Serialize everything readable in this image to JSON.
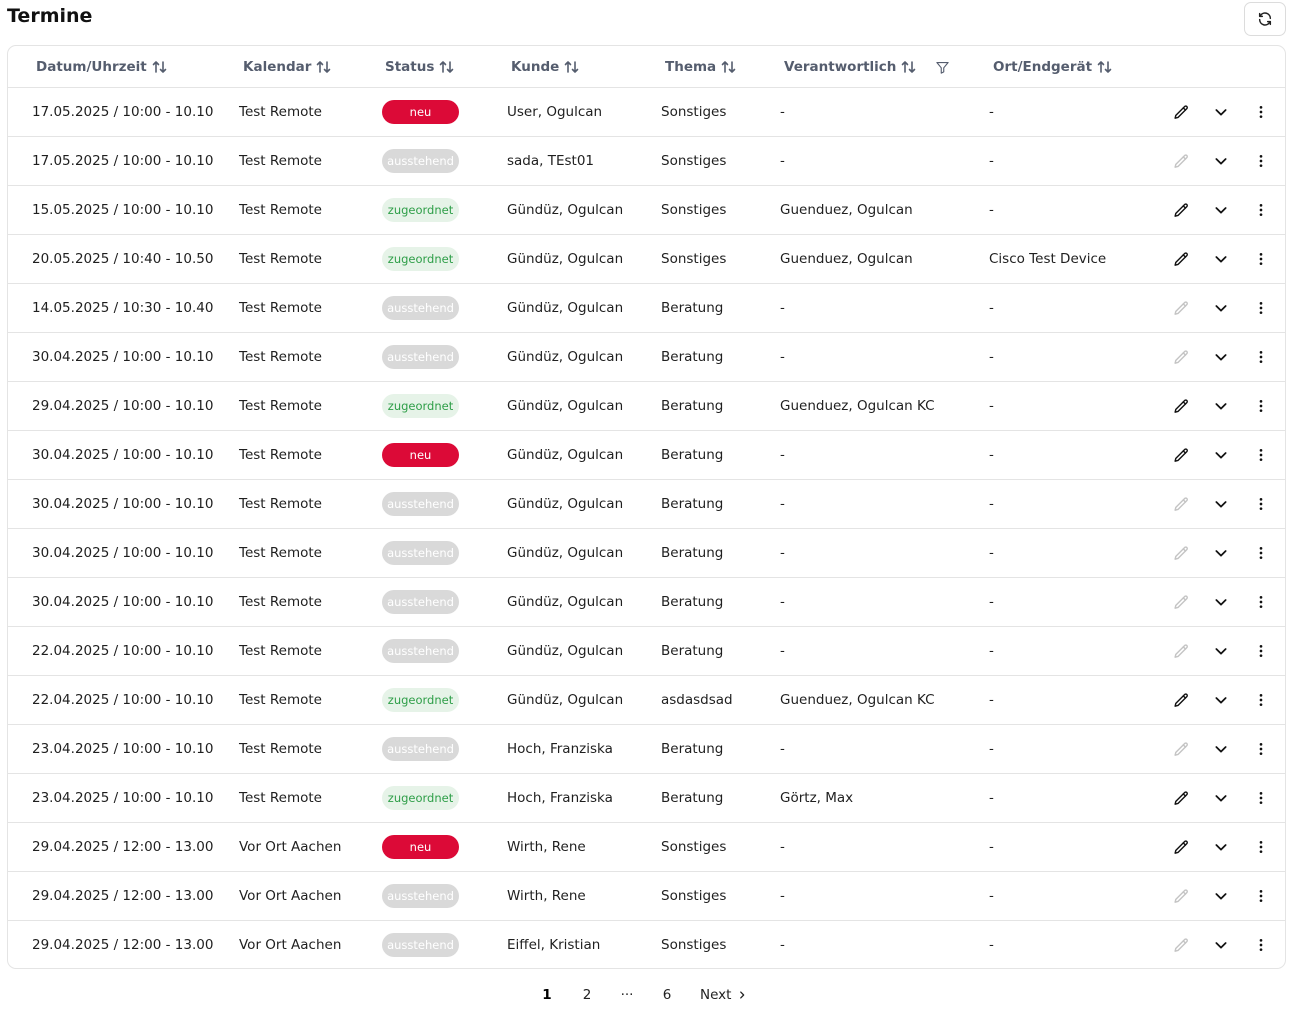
{
  "page": {
    "title": "Termine"
  },
  "toolbar": {
    "refresh_icon": "refresh-icon"
  },
  "table": {
    "columns": [
      {
        "key": "datum",
        "label": "Datum/Uhrzeit",
        "sortable": true,
        "filter": false
      },
      {
        "key": "kalender",
        "label": "Kalendar",
        "sortable": true,
        "filter": false
      },
      {
        "key": "status",
        "label": "Status",
        "sortable": true,
        "filter": false
      },
      {
        "key": "kunde",
        "label": "Kunde",
        "sortable": true,
        "filter": false
      },
      {
        "key": "thema",
        "label": "Thema",
        "sortable": true,
        "filter": false
      },
      {
        "key": "verantwortlich",
        "label": "Verantwortlich",
        "sortable": true,
        "filter": true
      },
      {
        "key": "ort",
        "label": "Ort/Endgerät",
        "sortable": true,
        "filter": false
      }
    ],
    "rows": [
      {
        "datum": "17.05.2025 / 10:00 - 10.10",
        "kalender": "Test Remote",
        "status": "neu",
        "kunde": "User, Ogulcan",
        "thema": "Sonstiges",
        "verantwortlich": "-",
        "ort": "-",
        "editable": true
      },
      {
        "datum": "17.05.2025 / 10:00 - 10.10",
        "kalender": "Test Remote",
        "status": "ausstehend",
        "kunde": "sada, TEst01",
        "thema": "Sonstiges",
        "verantwortlich": "-",
        "ort": "-",
        "editable": false
      },
      {
        "datum": "15.05.2025 / 10:00 - 10.10",
        "kalender": "Test Remote",
        "status": "zugeordnet",
        "kunde": "Gündüz, Ogulcan",
        "thema": "Sonstiges",
        "verantwortlich": "Guenduez, Ogulcan",
        "ort": "-",
        "editable": true
      },
      {
        "datum": "20.05.2025 / 10:40 - 10.50",
        "kalender": "Test Remote",
        "status": "zugeordnet",
        "kunde": "Gündüz, Ogulcan",
        "thema": "Sonstiges",
        "verantwortlich": "Guenduez, Ogulcan",
        "ort": "Cisco Test Device",
        "editable": true
      },
      {
        "datum": "14.05.2025 / 10:30 - 10.40",
        "kalender": "Test Remote",
        "status": "ausstehend",
        "kunde": "Gündüz, Ogulcan",
        "thema": "Beratung",
        "verantwortlich": "-",
        "ort": "-",
        "editable": false
      },
      {
        "datum": "30.04.2025 / 10:00 - 10.10",
        "kalender": "Test Remote",
        "status": "ausstehend",
        "kunde": "Gündüz, Ogulcan",
        "thema": "Beratung",
        "verantwortlich": "-",
        "ort": "-",
        "editable": false
      },
      {
        "datum": "29.04.2025 / 10:00 - 10.10",
        "kalender": "Test Remote",
        "status": "zugeordnet",
        "kunde": "Gündüz, Ogulcan",
        "thema": "Beratung",
        "verantwortlich": "Guenduez, Ogulcan KC",
        "ort": "-",
        "editable": true
      },
      {
        "datum": "30.04.2025 / 10:00 - 10.10",
        "kalender": "Test Remote",
        "status": "neu",
        "kunde": "Gündüz, Ogulcan",
        "thema": "Beratung",
        "verantwortlich": "-",
        "ort": "-",
        "editable": true
      },
      {
        "datum": "30.04.2025 / 10:00 - 10.10",
        "kalender": "Test Remote",
        "status": "ausstehend",
        "kunde": "Gündüz, Ogulcan",
        "thema": "Beratung",
        "verantwortlich": "-",
        "ort": "-",
        "editable": false
      },
      {
        "datum": "30.04.2025 / 10:00 - 10.10",
        "kalender": "Test Remote",
        "status": "ausstehend",
        "kunde": "Gündüz, Ogulcan",
        "thema": "Beratung",
        "verantwortlich": "-",
        "ort": "-",
        "editable": false
      },
      {
        "datum": "30.04.2025 / 10:00 - 10.10",
        "kalender": "Test Remote",
        "status": "ausstehend",
        "kunde": "Gündüz, Ogulcan",
        "thema": "Beratung",
        "verantwortlich": "-",
        "ort": "-",
        "editable": false
      },
      {
        "datum": "22.04.2025 / 10:00 - 10.10",
        "kalender": "Test Remote",
        "status": "ausstehend",
        "kunde": "Gündüz, Ogulcan",
        "thema": "Beratung",
        "verantwortlich": "-",
        "ort": "-",
        "editable": false
      },
      {
        "datum": "22.04.2025 / 10:00 - 10.10",
        "kalender": "Test Remote",
        "status": "zugeordnet",
        "kunde": "Gündüz, Ogulcan",
        "thema": "asdasdsad",
        "verantwortlich": "Guenduez, Ogulcan KC",
        "ort": "-",
        "editable": true
      },
      {
        "datum": "23.04.2025 / 10:00 - 10.10",
        "kalender": "Test Remote",
        "status": "ausstehend",
        "kunde": "Hoch, Franziska",
        "thema": "Beratung",
        "verantwortlich": "-",
        "ort": "-",
        "editable": false
      },
      {
        "datum": "23.04.2025 / 10:00 - 10.10",
        "kalender": "Test Remote",
        "status": "zugeordnet",
        "kunde": "Hoch, Franziska",
        "thema": "Beratung",
        "verantwortlich": "Görtz, Max",
        "ort": "-",
        "editable": true
      },
      {
        "datum": "29.04.2025 / 12:00 - 13.00",
        "kalender": "Vor Ort Aachen",
        "status": "neu",
        "kunde": "Wirth, Rene",
        "thema": "Sonstiges",
        "verantwortlich": "-",
        "ort": "-",
        "editable": true
      },
      {
        "datum": "29.04.2025 / 12:00 - 13.00",
        "kalender": "Vor Ort Aachen",
        "status": "ausstehend",
        "kunde": "Wirth, Rene",
        "thema": "Sonstiges",
        "verantwortlich": "-",
        "ort": "-",
        "editable": false
      },
      {
        "datum": "29.04.2025 / 12:00 - 13.00",
        "kalender": "Vor Ort Aachen",
        "status": "ausstehend",
        "kunde": "Eiffel, Kristian",
        "thema": "Sonstiges",
        "verantwortlich": "-",
        "ort": "-",
        "editable": false
      }
    ]
  },
  "pagination": {
    "pages": [
      "1",
      "2",
      "···",
      "6"
    ],
    "current": "1",
    "next_label": "Next"
  },
  "colors": {
    "neu": "#dc0a37",
    "ausstehend": "#d9d9d9",
    "zugeordnet_bg": "#e6f3e8",
    "zugeordnet_text": "#2e9e48",
    "edit_enabled": "#111111",
    "edit_disabled": "#c4c4c4"
  }
}
